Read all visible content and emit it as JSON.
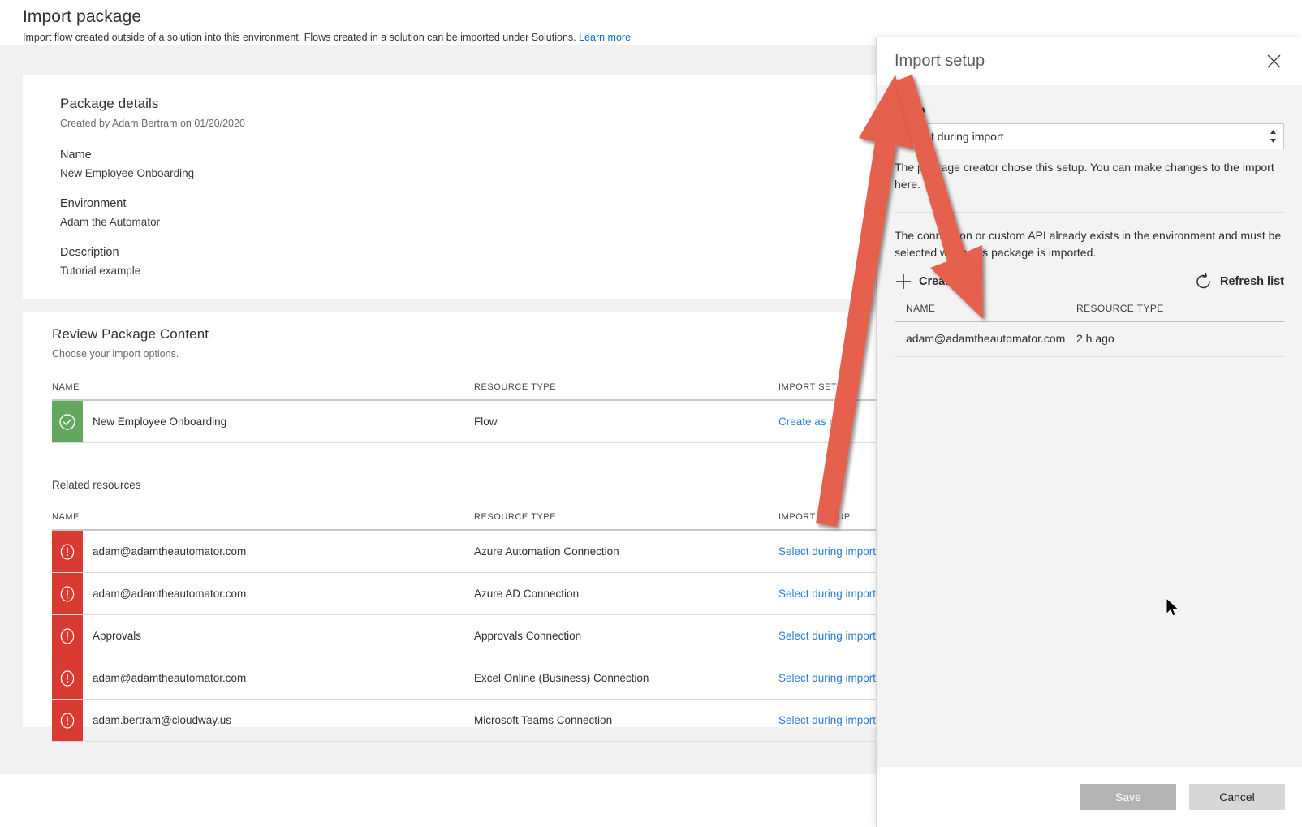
{
  "header": {
    "title": "Import package",
    "subtitle": "Import flow created outside of a solution into this environment. Flows created in a solution can be imported under Solutions.",
    "learn_more": "Learn more"
  },
  "package_details": {
    "section_title": "Package details",
    "created_by": "Created by Adam Bertram on 01/20/2020",
    "fields": [
      {
        "label": "Name",
        "value": "New Employee Onboarding"
      },
      {
        "label": "Environment",
        "value": "Adam the Automator"
      },
      {
        "label": "Description",
        "value": "Tutorial example"
      }
    ]
  },
  "review": {
    "section_title": "Review Package Content",
    "subtitle": "Choose your import options.",
    "columns": {
      "name": "NAME",
      "resource_type": "RESOURCE TYPE",
      "import_setup": "IMPORT SETUP"
    },
    "rows": [
      {
        "status": "ok",
        "name": "New Employee Onboarding",
        "resource_type": "Flow",
        "import_setup": "Create as new"
      }
    ],
    "related_label": "Related resources",
    "related_rows": [
      {
        "status": "error",
        "name": "adam@adamtheautomator.com",
        "resource_type": "Azure Automation Connection",
        "import_setup": "Select during import"
      },
      {
        "status": "error",
        "name": "adam@adamtheautomator.com",
        "resource_type": "Azure AD Connection",
        "import_setup": "Select during import"
      },
      {
        "status": "error",
        "name": "Approvals",
        "resource_type": "Approvals Connection",
        "import_setup": "Select during import"
      },
      {
        "status": "error",
        "name": "adam@adamtheautomator.com",
        "resource_type": "Excel Online (Business) Connection",
        "import_setup": "Select during import"
      },
      {
        "status": "error",
        "name": "adam.bertram@cloudway.us",
        "resource_type": "Microsoft Teams Connection",
        "import_setup": "Select during import"
      }
    ]
  },
  "panel": {
    "title": "Import setup",
    "close_label": "Close",
    "setup_label": "Setup",
    "setup_selected": "Select during import",
    "setup_options": [
      "Select during import"
    ],
    "help_text": "The package creator chose this setup. You can make changes to the import here.",
    "connection_text": "The connection or custom API already exists in the environment and must be selected when this package is imported.",
    "create_new_label": "Create new",
    "refresh_label": "Refresh list",
    "columns": {
      "name": "NAME",
      "resource_type": "RESOURCE TYPE"
    },
    "rows": [
      {
        "name": "adam@adamtheautomator.com",
        "resource_type": "2 h ago"
      }
    ],
    "save_label": "Save",
    "cancel_label": "Cancel"
  },
  "colors": {
    "accent_link": "#2b7cd3",
    "status_ok": "#61a75e",
    "status_error": "#d93a31",
    "annotation_arrow": "#e5614d",
    "page_background": "#f1f1f1",
    "panel_background": "#f3f3f3"
  }
}
